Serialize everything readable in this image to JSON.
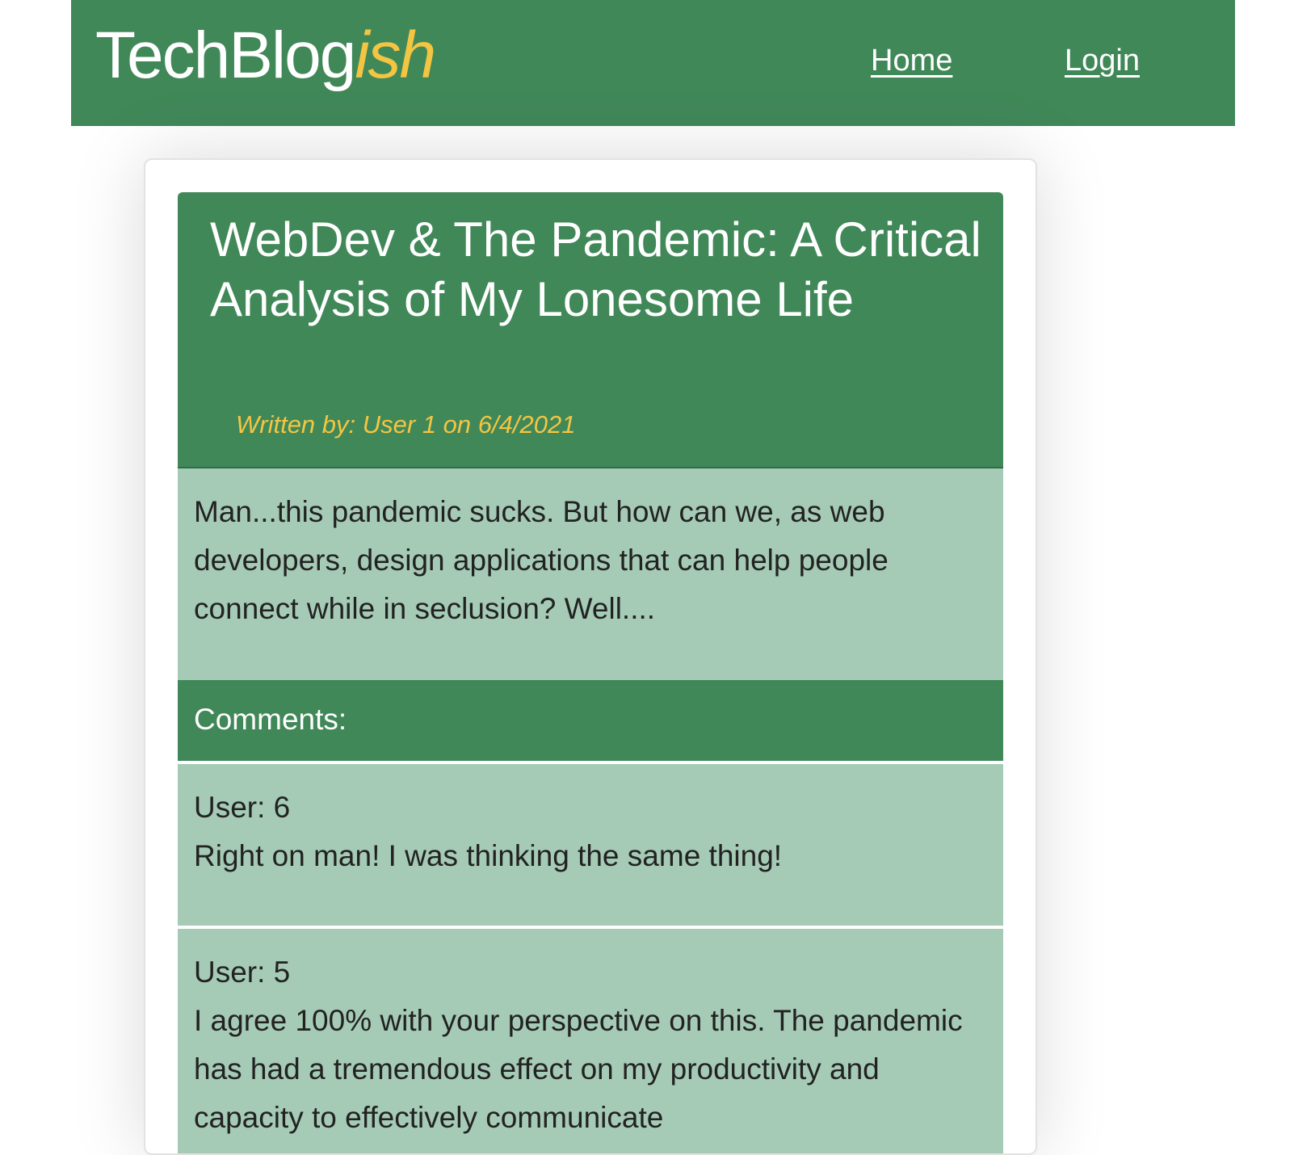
{
  "navbar": {
    "brand_main": "TechBlog",
    "brand_accent": "ish",
    "links": [
      {
        "label": "Home"
      },
      {
        "label": "Login"
      }
    ]
  },
  "post": {
    "title": "WebDev & The Pandemic: A Critical Analysis of My Lonesome Life",
    "meta": "Written by: User 1 on 6/4/2021",
    "body": "Man...this pandemic sucks. But how can we, as web developers, design applications that can help people connect while in seclusion? Well...."
  },
  "comments": {
    "header": "Comments:",
    "items": [
      {
        "user": "User: 6",
        "text": "Right on man! I was thinking the same thing!"
      },
      {
        "user": "User: 5",
        "text": "I agree 100% with your perspective on this. The pandemic has had a tremendous effect on my productivity and capacity to effectively communicate"
      }
    ]
  },
  "colors": {
    "primary_green": "#418859",
    "light_green": "#a5cbb6",
    "accent_yellow": "#f4c542"
  }
}
